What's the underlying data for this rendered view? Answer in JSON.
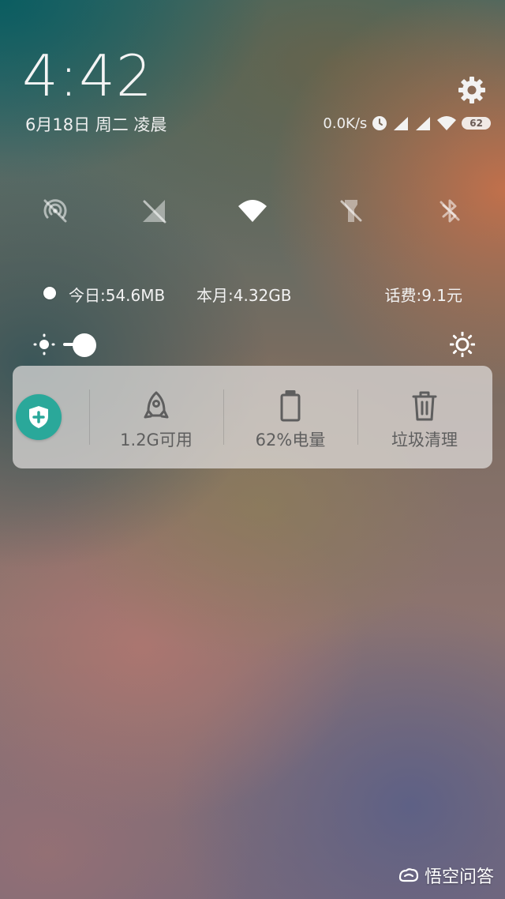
{
  "clock": {
    "time": "4:42",
    "date": "6月18日 周二 凌晨"
  },
  "status_bar": {
    "net_speed": "0.0K/s",
    "battery": "62"
  },
  "quick_toggles": [
    {
      "name": "hotspot",
      "icon": "hotspot-off-icon",
      "active": false
    },
    {
      "name": "mobile-data",
      "icon": "mobile-data-off-icon",
      "active": false
    },
    {
      "name": "wifi",
      "icon": "wifi-icon",
      "active": true
    },
    {
      "name": "flashlight",
      "icon": "flashlight-off-icon",
      "active": false
    },
    {
      "name": "bluetooth",
      "icon": "bluetooth-off-icon",
      "active": false
    }
  ],
  "data_usage": {
    "today": "今日:54.6MB",
    "month": "本月:4.32GB",
    "balance": "话费:9.1元"
  },
  "brightness": {
    "level": 0.05
  },
  "tools_card": {
    "shield_icon": "shield-plus-icon",
    "items": [
      {
        "icon": "rocket-icon",
        "label": "1.2G可用"
      },
      {
        "icon": "battery-icon",
        "label": "62%电量"
      },
      {
        "icon": "trash-icon",
        "label": "垃圾清理"
      }
    ]
  },
  "watermark": {
    "text": "悟空问答"
  },
  "colors": {
    "shield": "#2aa89a",
    "card_text": "#5e5e5e"
  }
}
